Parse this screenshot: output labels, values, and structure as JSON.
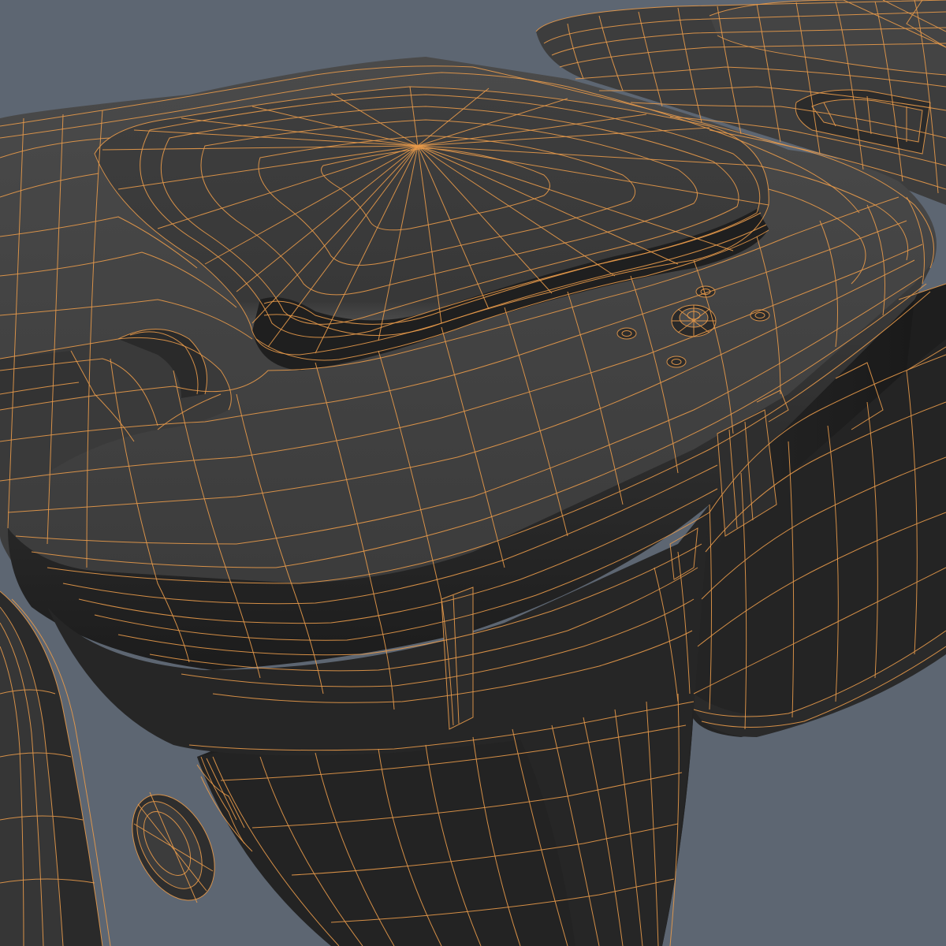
{
  "scene": {
    "background_color": "#5d6672",
    "mesh_fill": "#3a3a3a",
    "mesh_fill_dark": "#242424",
    "mesh_fill_light": "#4a4a4a",
    "wire_color": "#e89a4a",
    "subject": "wireframe-render-wheelie-bins"
  }
}
